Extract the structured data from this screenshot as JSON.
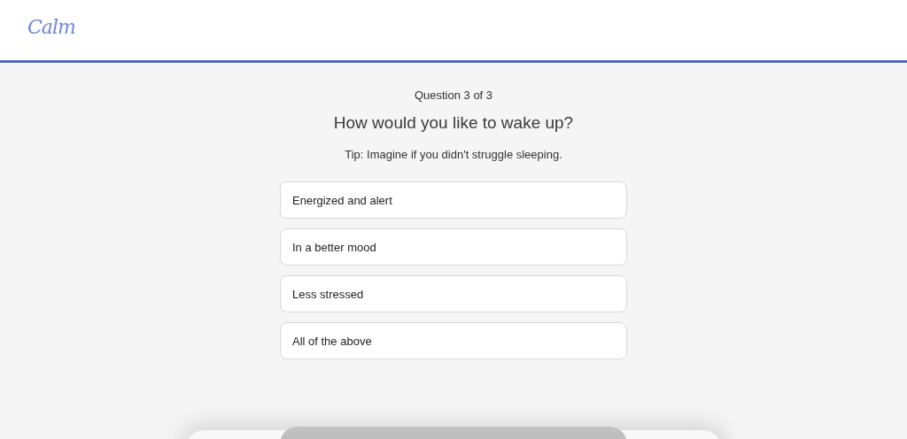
{
  "header": {
    "logo": "Calm"
  },
  "quiz": {
    "progress": "Question 3 of 3",
    "question": "How would you like to wake up?",
    "tip": "Tip: Imagine if you didn't struggle sleeping."
  },
  "options": [
    {
      "label": "Energized and alert",
      "selected": false
    },
    {
      "label": "In a better mood",
      "selected": false
    },
    {
      "label": "Less stressed",
      "selected": false
    },
    {
      "label": "All of the above",
      "selected": false
    }
  ],
  "continue_button": {
    "disabled": true
  }
}
